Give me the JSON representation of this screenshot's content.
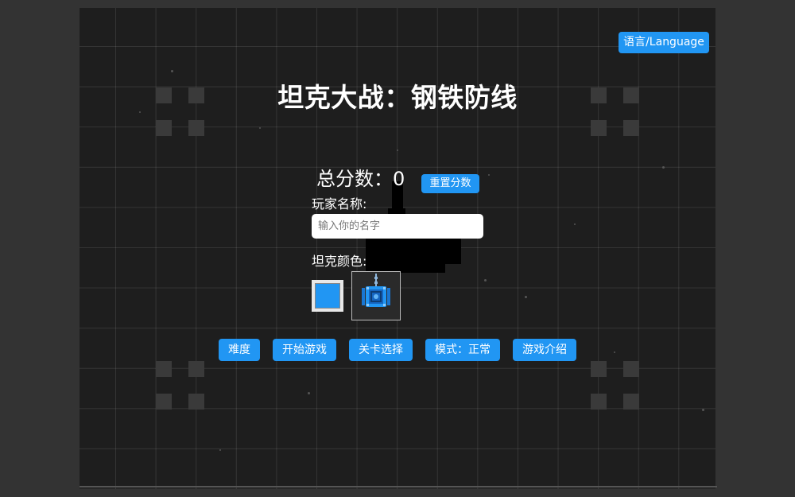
{
  "language_button": "语言/Language",
  "title": "坦克大战：钢铁防线",
  "score": {
    "label": "总分数：",
    "value": "0",
    "reset_button": "重置分数"
  },
  "player": {
    "label": "玩家名称:",
    "placeholder": "输入你的名字",
    "value": ""
  },
  "tank_color": {
    "label": "坦克颜色:",
    "selected": "#2196f3"
  },
  "menu": {
    "difficulty": "难度",
    "start": "开始游戏",
    "level_select": "关卡选择",
    "mode": "模式：正常",
    "intro": "游戏介绍"
  },
  "colors": {
    "accent": "#2196f3",
    "background": "#1e1e1e",
    "page": "#333333"
  }
}
